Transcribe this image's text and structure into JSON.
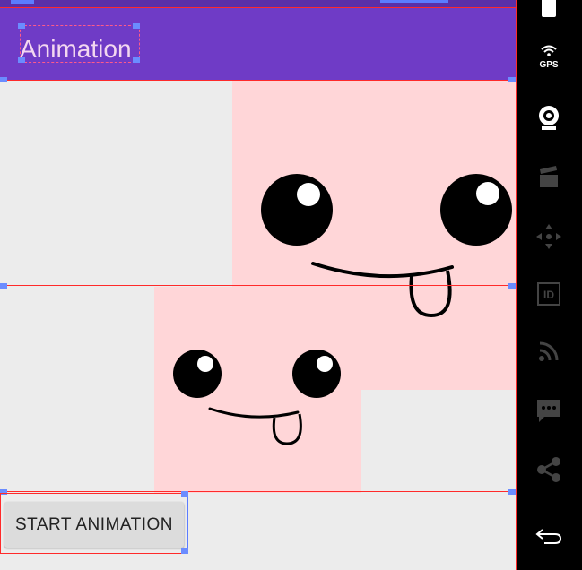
{
  "toolbar": {
    "title": "Animation"
  },
  "main": {
    "button_label": "START ANIMATION"
  },
  "emulator": {
    "gps_label": "GPS",
    "id_label": "ID",
    "icons": [
      "battery-icon",
      "gps-icon",
      "camera-icon",
      "clapperboard-icon",
      "dpad-icon",
      "id-icon",
      "rss-icon",
      "message-icon",
      "share-icon",
      "back-icon"
    ]
  },
  "colors": {
    "toolbar": "#6f3bc6",
    "face_background": "#ffd6d8",
    "app_background": "#ececec"
  }
}
